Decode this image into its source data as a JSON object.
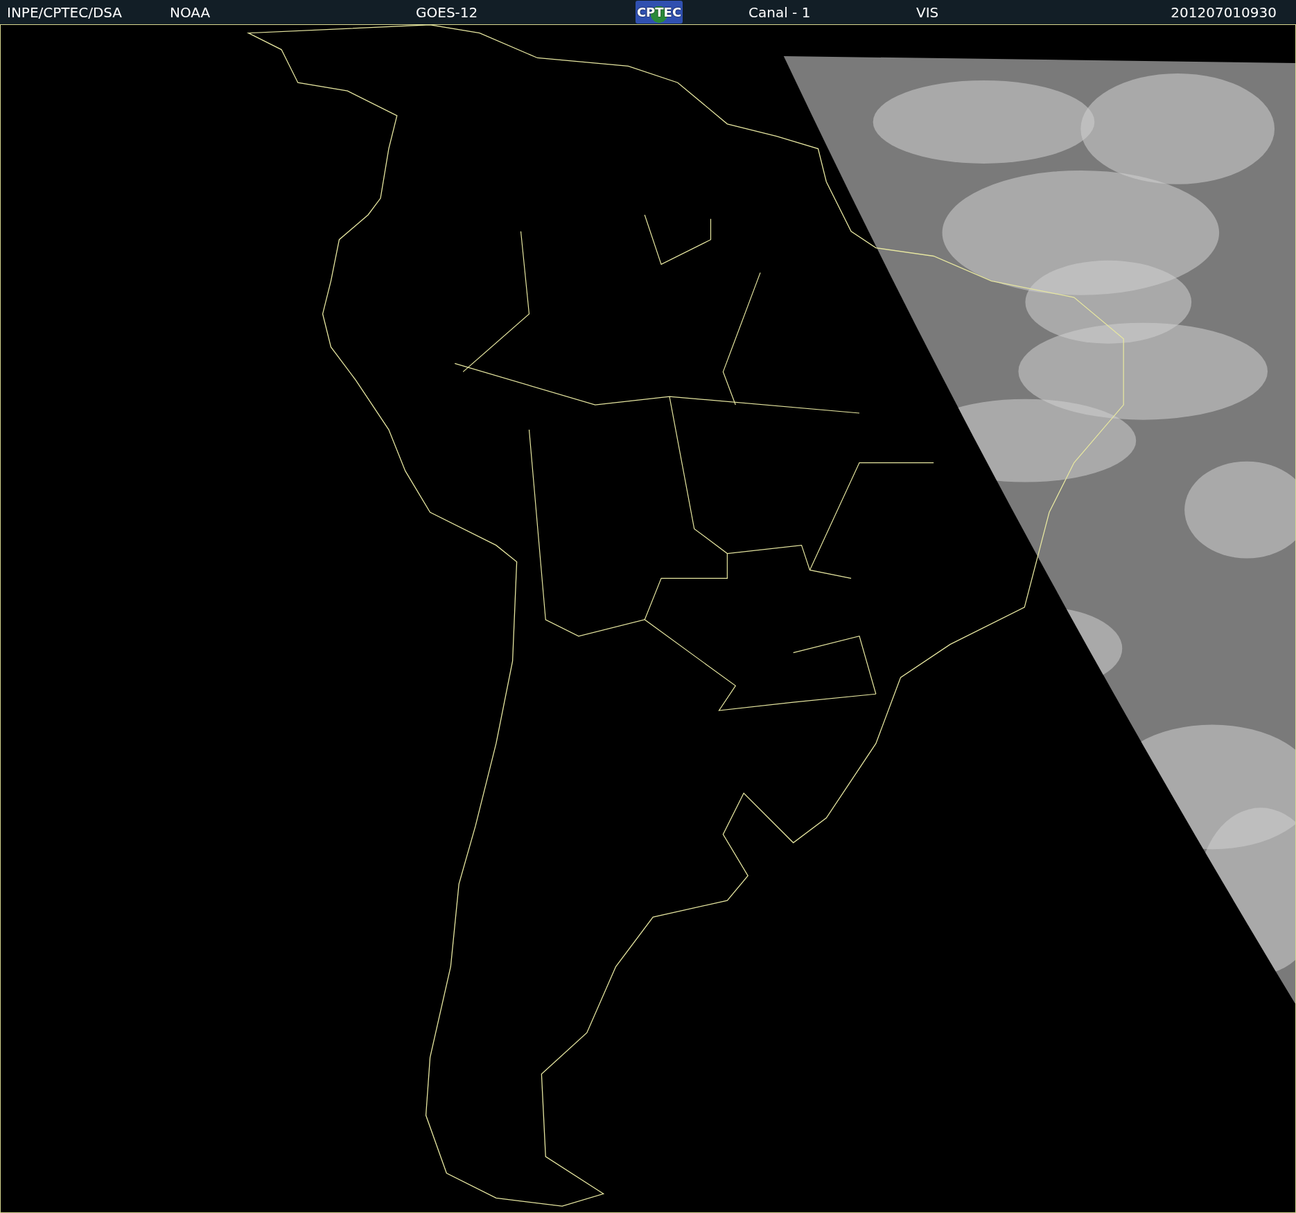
{
  "header": {
    "items": [
      {
        "kind": "text",
        "text": "INPE/CPTEC/DSA"
      },
      {
        "kind": "text",
        "text": "NOAA"
      },
      {
        "kind": "text",
        "text": "GOES-12"
      },
      {
        "kind": "logo",
        "text": "CPTEC"
      },
      {
        "kind": "text",
        "text": "Canal - 1"
      },
      {
        "kind": "text",
        "text": "VIS"
      },
      {
        "kind": "text",
        "text": "201207010930"
      }
    ]
  }
}
